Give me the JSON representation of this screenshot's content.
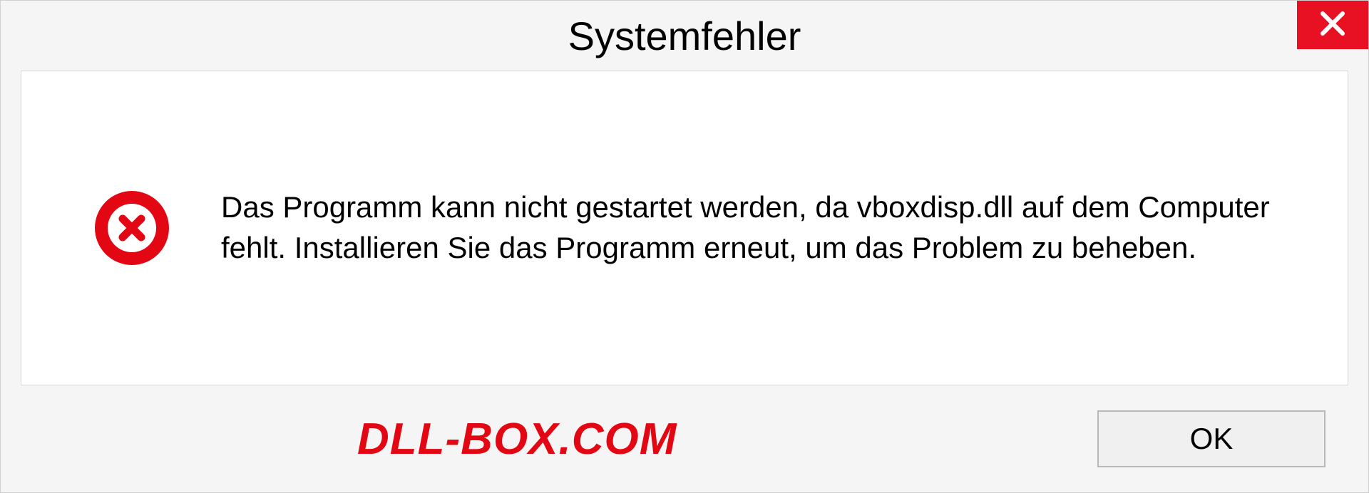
{
  "dialog": {
    "title": "Systemfehler",
    "message": "Das Programm kann nicht gestartet werden, da vboxdisp.dll auf dem Computer fehlt. Installieren Sie das Programm erneut, um das Problem zu beheben.",
    "ok_label": "OK"
  },
  "watermark": "DLL-BOX.COM"
}
